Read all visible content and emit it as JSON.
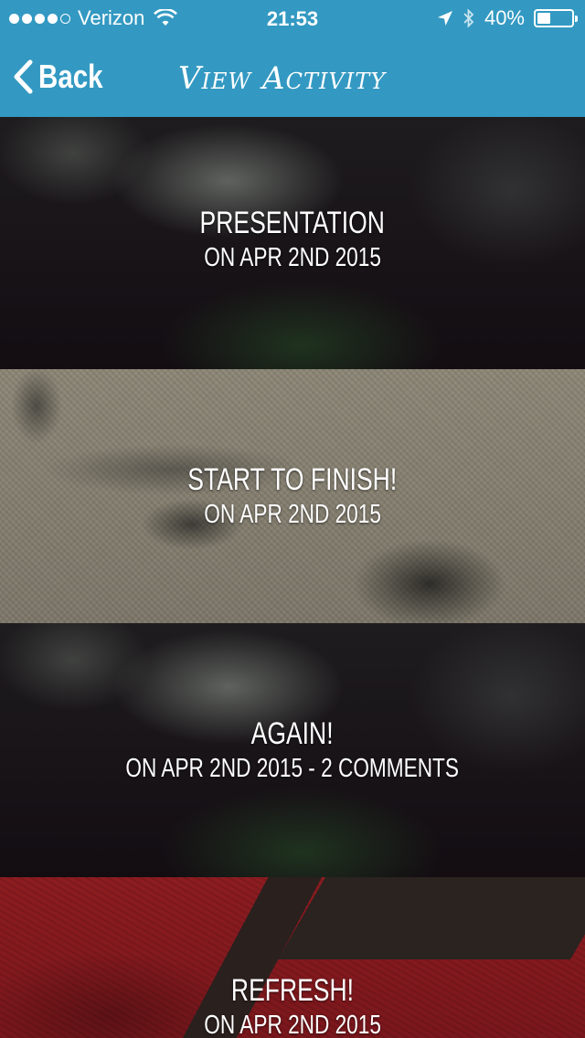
{
  "status_bar": {
    "carrier": "Verizon",
    "signal_bars_filled": 4,
    "signal_bars_total": 5,
    "time": "21:53",
    "battery_percent": "40%",
    "battery_level": 0.4
  },
  "nav": {
    "back_label": "Back",
    "title": "View Activity"
  },
  "activities": [
    {
      "title": "Presentation",
      "subtitle": "On Apr 2nd 2015"
    },
    {
      "title": "Start to Finish!",
      "subtitle": "On Apr 2nd 2015"
    },
    {
      "title": "Again!",
      "subtitle": "On Apr 2nd 2015 - 2 Comments"
    },
    {
      "title": "Refresh!",
      "subtitle": "On Apr 2nd 2015"
    }
  ],
  "colors": {
    "header_bg": "#3399c2",
    "text": "#ffffff"
  }
}
